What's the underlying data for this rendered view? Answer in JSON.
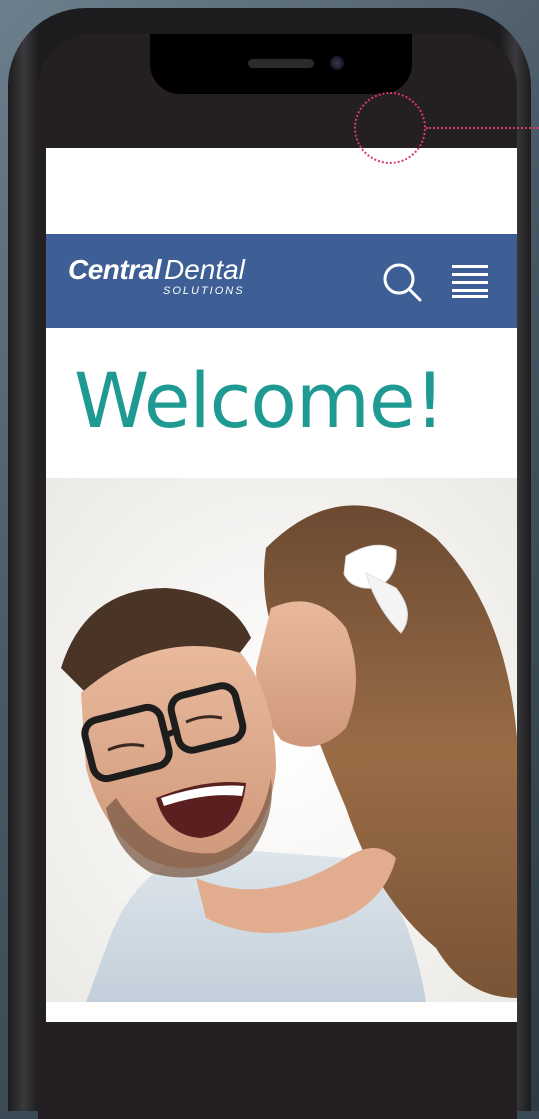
{
  "site": {
    "logo_main_bold": "Central",
    "logo_main_light": "Dental",
    "logo_sub": "SOLUTIONS"
  },
  "nav": {
    "search_icon": "search-icon",
    "menu_icon": "hamburger-menu-icon"
  },
  "main": {
    "heading": "Welcome!"
  },
  "colors": {
    "nav_bg": "#3e5f95",
    "heading": "#1f9a93",
    "indicator": "#d83b6a"
  }
}
